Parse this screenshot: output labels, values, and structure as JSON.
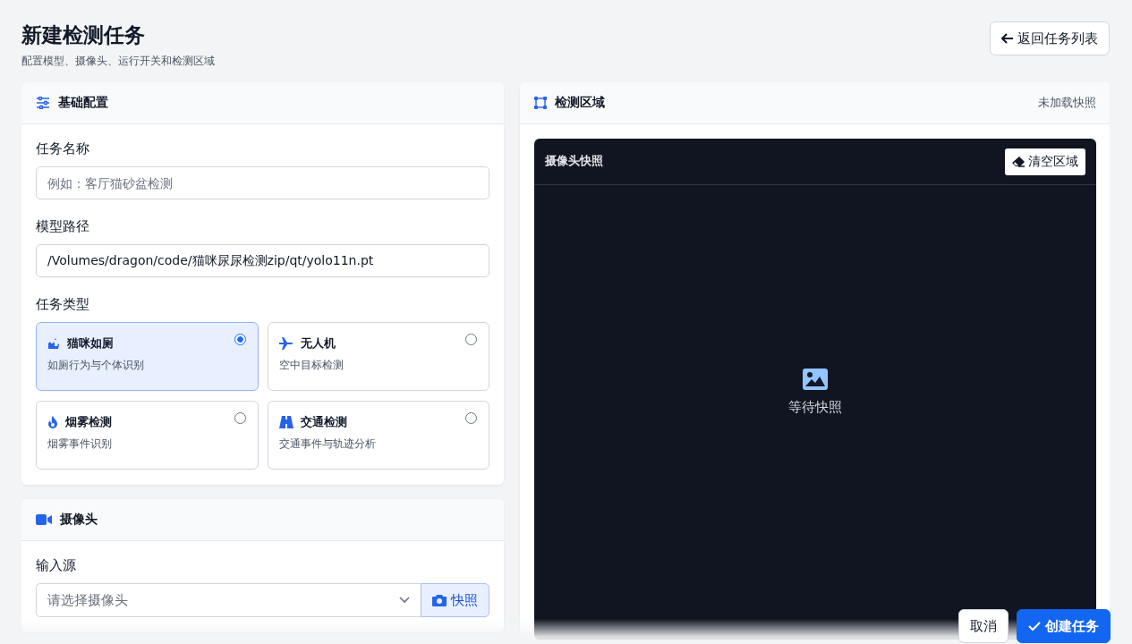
{
  "header": {
    "title": "新建检测任务",
    "subtitle": "配置模型、摄像头、运行开关和检测区域",
    "back_button": "返回任务列表"
  },
  "basic_config": {
    "title": "基础配置",
    "fields": [
      {
        "label": "任务名称",
        "placeholder": "例如：客厅猫砂盆检测"
      },
      {
        "label": "模型路径",
        "value": "/Volumes/dragon/code/猫咪尿尿检测zip/qt/yolo11n.pt"
      }
    ],
    "task_type": {
      "label": "任务类型",
      "options": [
        {
          "title": "猫咪如厕",
          "description": "如厕行为与个体识别",
          "selected": true
        },
        {
          "title": "无人机",
          "description": "空中目标检测",
          "selected": false
        },
        {
          "title": "烟雾检测",
          "description": "烟雾事件识别",
          "selected": false
        },
        {
          "title": "交通检测",
          "description": "交通事件与轨迹分析",
          "selected": false
        }
      ]
    }
  },
  "camera": {
    "title": "摄像头",
    "input_source": {
      "label": "输入源",
      "placeholder": "请选择摄像头",
      "snapshot_button": "快照"
    }
  },
  "region": {
    "title": "检测区域",
    "status": "未加载快照",
    "preview": {
      "title": "摄像头快照",
      "clear_button": "清空区域",
      "empty_text": "等待快照"
    }
  },
  "footer": {
    "cancel": "取消",
    "create": "创建任务"
  }
}
